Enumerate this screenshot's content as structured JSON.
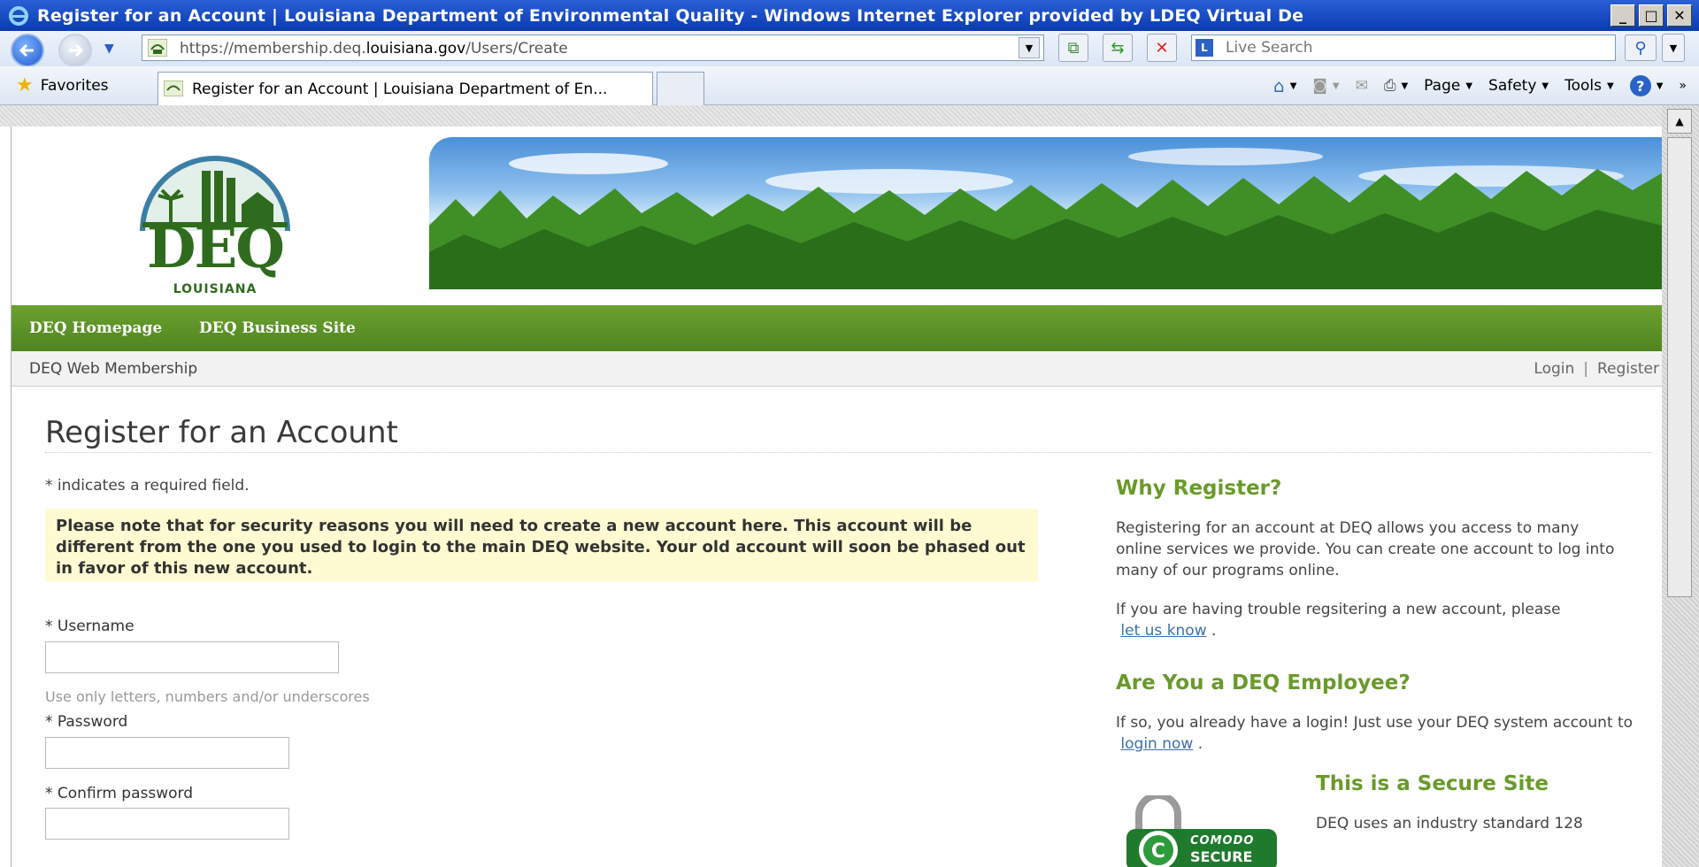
{
  "window": {
    "title": "Register for an Account | Louisiana Department of Environmental Quality - Windows Internet Explorer provided by LDEQ Virtual De"
  },
  "address": {
    "url_prefix": "https://membership.deq.",
    "url_host": "louisiana.gov",
    "url_path": "/Users/Create"
  },
  "search": {
    "placeholder": "Live Search"
  },
  "favorites": {
    "label": "Favorites"
  },
  "tab": {
    "label": "Register for an Account | Louisiana Department of En..."
  },
  "command_bar": {
    "page": "Page",
    "safety": "Safety",
    "tools": "Tools"
  },
  "logo": {
    "word": "DEQ",
    "state": "LOUISIANA"
  },
  "nav": {
    "homepage": "DEQ Homepage",
    "business": "DEQ Business Site"
  },
  "subnav": {
    "site_name": "DEQ Web Membership",
    "login": "Login",
    "separator": "|",
    "register": "Register"
  },
  "main": {
    "title": "Register for an Account",
    "required_note": "* indicates a required field.",
    "notice": "Please note that for security reasons you will need to create a new account here. This account will be different from the one you used to login to the main DEQ website. Your old account will soon be phased out in favor of this new account.",
    "username_label": "* Username",
    "username_hint": "Use only letters, numbers and/or underscores",
    "password_label": "* Password",
    "confirm_label": "* Confirm password"
  },
  "sidebar": {
    "why_title": "Why Register?",
    "why_text": "Registering for an account at DEQ allows you access to many online services we provide. You can create one account to log into many of our programs online.",
    "trouble_text": "If you are having trouble regsitering a new account, please",
    "trouble_link": "let us know",
    "trouble_end": ".",
    "employee_title": "Are You a DEQ Employee?",
    "employee_text": "If so, you already have a login! Just use your DEQ system account to",
    "employee_link": "login now",
    "employee_end": ".",
    "secure_title": "This is a Secure Site",
    "secure_text": "DEQ uses an industry standard 128",
    "comodo_top": "COMODO",
    "comodo_bottom": "SECURE"
  },
  "colors": {
    "green_nav": "#5a8f25",
    "heading_green": "#6a9a2b",
    "notice_bg": "#fefbd3",
    "ie_title": "#0a3bb0"
  }
}
